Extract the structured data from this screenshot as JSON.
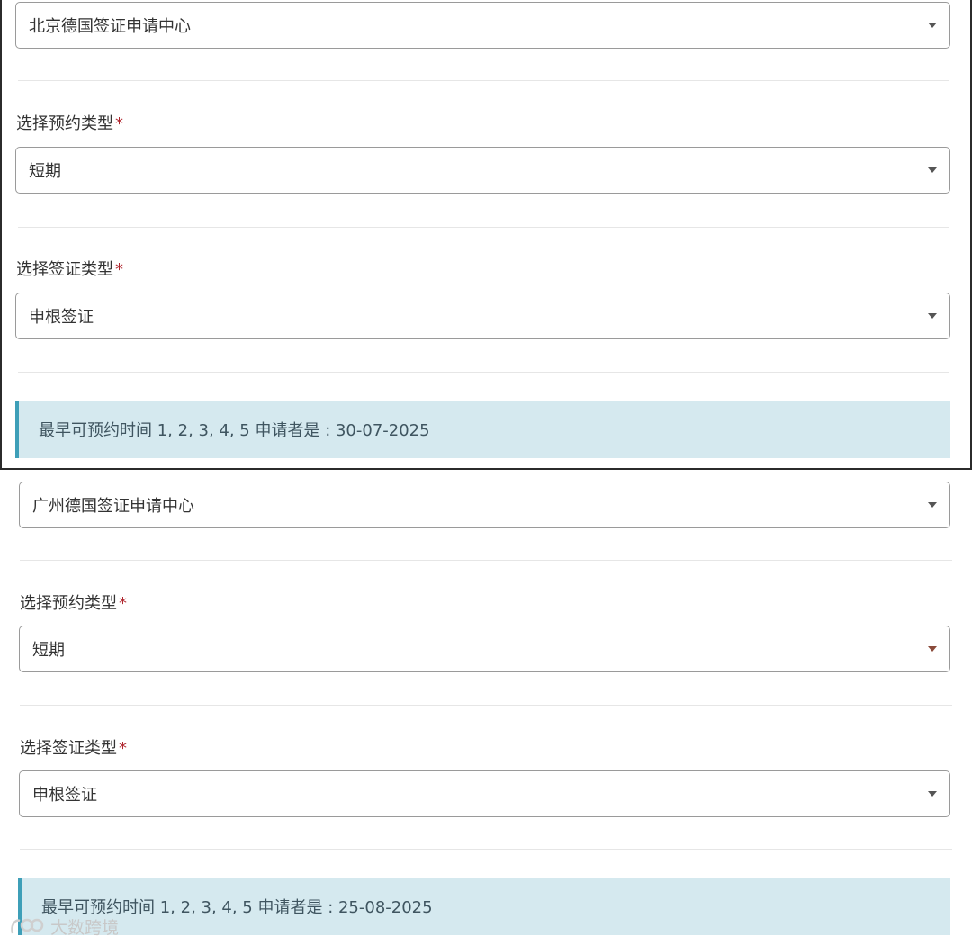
{
  "panels": [
    {
      "center_select": {
        "value": "北京德国签证申请中心"
      },
      "appointment_type": {
        "label": "选择预约类型",
        "required_mark": "*",
        "value": "短期"
      },
      "visa_type": {
        "label": "选择签证类型",
        "required_mark": "*",
        "value": "申根签证"
      },
      "availability_notice": "最早可预约时间 1, 2, 3, 4, 5 申请者是 : 30-07-2025"
    },
    {
      "center_select": {
        "value": "广州德国签证申请中心"
      },
      "appointment_type": {
        "label": "选择预约类型",
        "required_mark": "*",
        "value": "短期"
      },
      "visa_type": {
        "label": "选择签证类型",
        "required_mark": "*",
        "value": "申根签证"
      },
      "availability_notice": "最早可预约时间 1, 2, 3, 4, 5 申请者是 : 25-08-2025"
    }
  ],
  "watermark": {
    "text": "大数跨境",
    "icon": "logo-icon"
  },
  "colors": {
    "required": "#b0272f",
    "alert_bg": "#d5e9ef",
    "alert_border": "#3e9fb8",
    "panel_border": "#2b2b2b"
  }
}
